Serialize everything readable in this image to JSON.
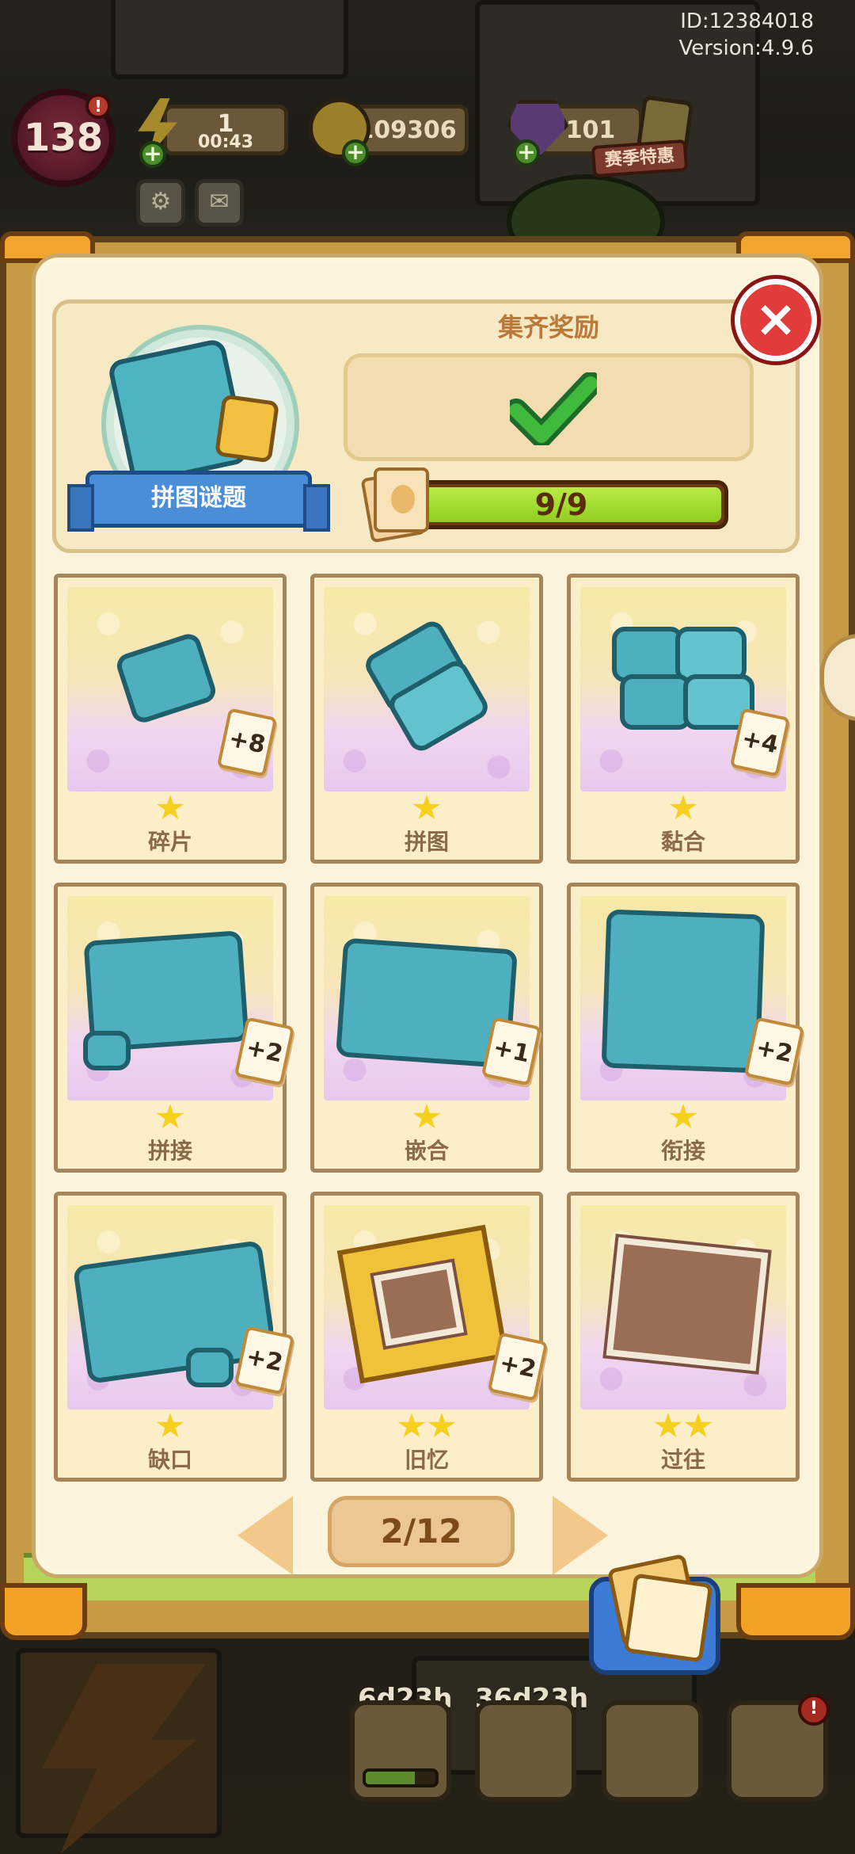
{
  "hud": {
    "player_id": "ID:12384018",
    "version": "Version:4.9.6",
    "level": "138",
    "level_alert": "!",
    "energy_value": "1",
    "energy_timer": "00:43",
    "coins": "109306",
    "gems": "101",
    "event_label": "赛季特惠",
    "icons": [
      "energy-icon",
      "coin-icon",
      "gem-icon",
      "settings-icon",
      "mail-icon"
    ]
  },
  "album": {
    "collection_name": "拼图谜题",
    "reward_title": "集齐奖励",
    "reward_status": "claimed",
    "progress_text": "9/9",
    "progress": 1.0,
    "close_label": "×"
  },
  "cards": [
    {
      "name": "碎片",
      "stars": 1,
      "duplicates": "+8"
    },
    {
      "name": "拼图",
      "stars": 1,
      "duplicates": ""
    },
    {
      "name": "黏合",
      "stars": 1,
      "duplicates": "+4"
    },
    {
      "name": "拼接",
      "stars": 1,
      "duplicates": "+2"
    },
    {
      "name": "嵌合",
      "stars": 1,
      "duplicates": "+1"
    },
    {
      "name": "衔接",
      "stars": 1,
      "duplicates": "+2"
    },
    {
      "name": "缺口",
      "stars": 1,
      "duplicates": "+2"
    },
    {
      "name": "旧忆",
      "stars": 2,
      "duplicates": "+2"
    },
    {
      "name": "过往",
      "stars": 2,
      "duplicates": ""
    }
  ],
  "pagination": {
    "label": "2/12"
  },
  "dock": {
    "timer_1": "6d23h",
    "timer_2": "36d23h",
    "alert": "!"
  }
}
